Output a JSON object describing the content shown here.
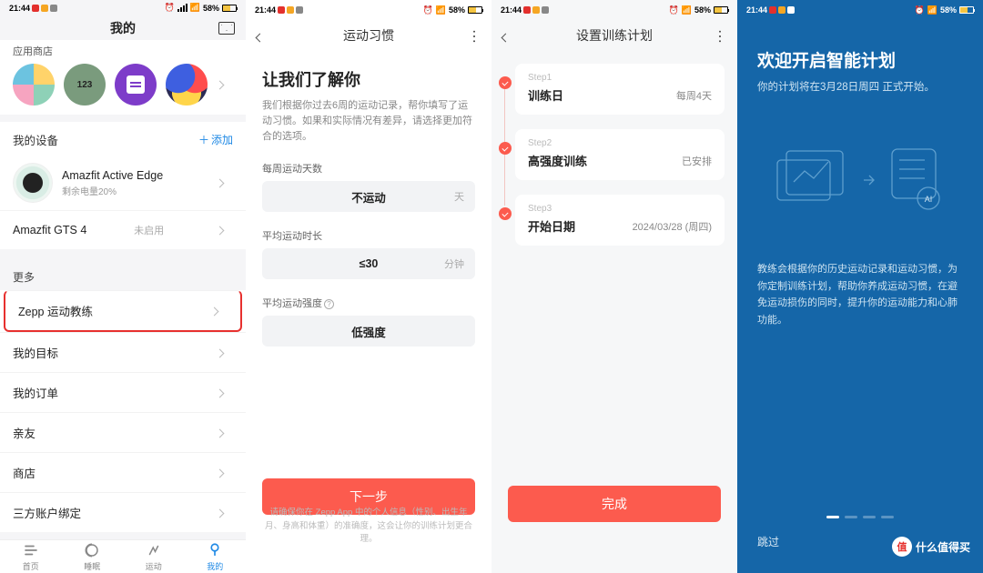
{
  "status": {
    "time": "21:44",
    "battery": "58%"
  },
  "p1": {
    "header_title": "我的",
    "app_store_label": "应用商店",
    "app2_label": "123",
    "devices_label": "我的设备",
    "add_label": "添加",
    "device1_name": "Amazfit Active Edge",
    "device1_sub": "剩余电量20%",
    "device2_name": "Amazfit GTS 4",
    "device2_status": "未启用",
    "more_label": "更多",
    "items": {
      "coach": "Zepp 运动教练",
      "goal": "我的目标",
      "orders": "我的订单",
      "friends": "亲友",
      "store": "商店",
      "thirdparty": "三方账户绑定"
    },
    "tabs": {
      "home": "首页",
      "sleep": "睡眠",
      "sport": "运动",
      "mine": "我的"
    }
  },
  "p2": {
    "nav_title": "运动习惯",
    "h1": "让我们了解你",
    "desc": "我们根据你过去6周的运动记录，帮你填写了运动习惯。如果和实际情况有差异，请选择更加符合的选项。",
    "f1_label": "每周运动天数",
    "f1_val": "不运动",
    "f1_unit": "天",
    "f2_label": "平均运动时长",
    "f2_val": "≤30",
    "f2_unit": "分钟",
    "f3_label": "平均运动强度",
    "f3_val": "低强度",
    "cta": "下一步",
    "footnote": "请确保你在 Zepp App 中的个人信息（性别、出生年月、身高和体重）的准确度，这会让你的训练计划更合理。"
  },
  "p3": {
    "nav_title": "设置训练计划",
    "step1_pre": "Step1",
    "step1_title": "训练日",
    "step1_val": "每周4天",
    "step2_pre": "Step2",
    "step2_title": "高强度训练",
    "step2_val": "已安排",
    "step3_pre": "Step3",
    "step3_title": "开始日期",
    "step3_val": "2024/03/28 (周四)",
    "cta": "完成"
  },
  "p4": {
    "h1": "欢迎开启智能计划",
    "sub": "你的计划将在3月28日周四 正式开始。",
    "para": "教练会根据你的历史运动记录和运动习惯，为你定制训练计划，帮助你养成运动习惯，在避免运动损伤的同时，提升你的运动能力和心肺功能。",
    "skip": "跳过",
    "badge": "什么值得买",
    "badge_char": "值"
  }
}
